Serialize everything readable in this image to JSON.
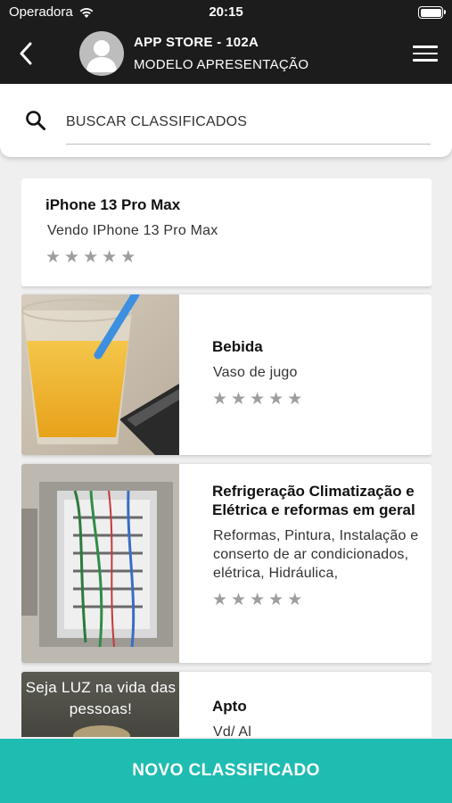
{
  "status_bar": {
    "carrier": "Operadora",
    "time": "20:15",
    "wifi_icon": "wifi-icon",
    "battery_icon": "battery-icon"
  },
  "header": {
    "title": "APP STORE - 102A",
    "subtitle": "MODELO APRESENTAÇÃO",
    "back_icon": "chevron-left-icon",
    "menu_icon": "hamburger-menu-icon",
    "avatar_icon": "user-avatar-icon"
  },
  "search": {
    "placeholder": "BUSCAR CLASSIFICADOS",
    "value": ""
  },
  "listings": [
    {
      "title": "iPhone 13 Pro Max",
      "description": "Vendo IPhone 13 Pro Max",
      "rating": 0,
      "max_rating": 5,
      "has_image": false
    },
    {
      "title": "Bebida",
      "description": "Vaso de jugo",
      "rating": 0,
      "max_rating": 5,
      "has_image": true
    },
    {
      "title": "Refrigeração Climatização e Elétrica e reformas em geral",
      "description": "Reformas, Pintura, Instalação e conserto de ar condicionados, elétrica, Hidráulica,",
      "rating": 0,
      "max_rating": 5,
      "has_image": true
    },
    {
      "title": "Apto",
      "description": "Vd/ Al",
      "rating": 0,
      "max_rating": 5,
      "has_image": true,
      "image_text": "Seja LUZ na vida das pessoas!"
    }
  ],
  "new_listing_button": "NOVO CLASSIFICADO",
  "colors": {
    "top_bar": "#1c1c1c",
    "accent": "#1fbcb1",
    "star": "#9e9e9e",
    "background": "#efefef"
  }
}
